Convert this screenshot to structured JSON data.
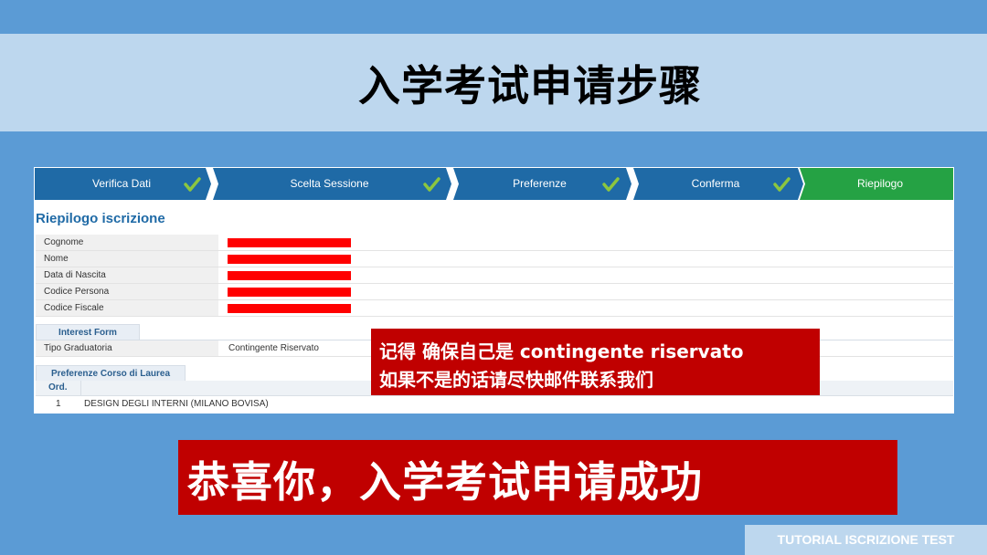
{
  "slide": {
    "title": "入学考试申请步骤"
  },
  "wizard": {
    "steps": [
      {
        "label": "Verifica Dati",
        "done": true,
        "state": "completed"
      },
      {
        "label": "Scelta Sessione",
        "done": true,
        "state": "completed"
      },
      {
        "label": "Preferenze",
        "done": true,
        "state": "completed"
      },
      {
        "label": "Conferma",
        "done": true,
        "state": "completed"
      },
      {
        "label": "Riepilogo",
        "done": false,
        "state": "active"
      }
    ],
    "colors": {
      "completed": "#1f6aa6",
      "active": "#25a244",
      "check": "#8cc63f"
    }
  },
  "summary": {
    "heading": "Riepilogo iscrizione",
    "fields": [
      {
        "label": "Cognome",
        "redacted": true
      },
      {
        "label": "Nome",
        "redacted": true
      },
      {
        "label": "Data di Nascita",
        "redacted": true
      },
      {
        "label": "Codice Persona",
        "redacted": true
      },
      {
        "label": "Codice Fiscale",
        "redacted": true
      }
    ],
    "interest_form": {
      "tab_label": "Interest Form",
      "label": "Tipo Graduatoria",
      "value": "Contingente Riservato"
    },
    "preferences": {
      "tab_label": "Preferenze Corso di Laurea",
      "column_header": "Ord.",
      "rows": [
        {
          "ord": "1",
          "course": "DESIGN DEGLI INTERNI (MILANO BOVISA)"
        }
      ]
    }
  },
  "note": {
    "line1": "记得 确保自己是 contingente riservato",
    "line2": "如果不是的话请尽快邮件联系我们"
  },
  "banner": {
    "text": "恭喜你，入学考试申请成功"
  },
  "footer": {
    "text": "TUTORIAL ISCRIZIONE TEST"
  }
}
